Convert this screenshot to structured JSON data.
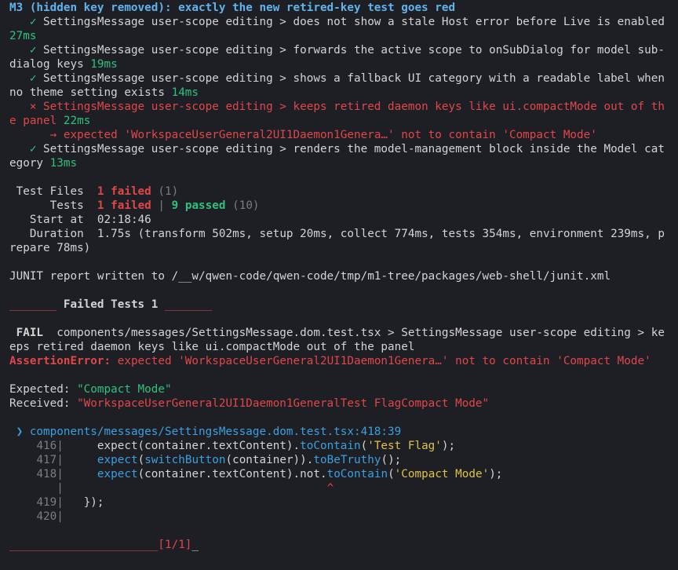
{
  "header": "M3 (hidden key removed): exactly the new retired-key test goes red",
  "tests": [
    {
      "mark": "✓",
      "status": "pass",
      "text": "SettingsMessage user-scope editing > does not show a stale Host error before Live is enabled ",
      "time": "27ms"
    },
    {
      "mark": "✓",
      "status": "pass",
      "text": "SettingsMessage user-scope editing > forwards the active scope to onSubDialog for model sub-dialog keys ",
      "time": "19ms"
    },
    {
      "mark": "✓",
      "status": "pass",
      "text": "SettingsMessage user-scope editing > shows a fallback UI category with a readable label when no theme setting exists ",
      "time": "14ms"
    },
    {
      "mark": "×",
      "status": "fail",
      "text": "SettingsMessage user-scope editing > keeps retired daemon keys like ui.compactMode out of the panel ",
      "time": "22ms",
      "error": "→ expected 'WorkspaceUserGeneral2UI1Daemon1Genera…' not to contain 'Compact Mode'"
    },
    {
      "mark": "✓",
      "status": "pass",
      "text": "SettingsMessage user-scope editing > renders the model-management block inside the Model category ",
      "time": "13ms"
    }
  ],
  "summary": {
    "files_label": "Test Files",
    "files_failed": "1 failed",
    "files_total": "(1)",
    "tests_label": "Tests",
    "tests_failed": "1 failed",
    "tests_sep": "|",
    "tests_passed": "9 passed",
    "tests_total": "(10)",
    "start_label": "Start at",
    "start_value": "02:18:46",
    "duration_label": "Duration",
    "duration_value": "1.75s (transform 502ms, setup 20ms, collect 774ms, tests 354ms, environment 239ms, prepare 78ms)"
  },
  "junit": "JUNIT report written to /__w/qwen-code/qwen-code/tmp/m1-tree/packages/web-shell/junit.xml",
  "failed_tests": {
    "rule_left": "_______",
    "title": "Failed Tests 1",
    "rule_right": "_______"
  },
  "fail_block": {
    "badge": "FAIL",
    "path": "components/messages/SettingsMessage.dom.test.tsx > SettingsMessage user-scope editing > keeps retired daemon keys like ui.compactMode out of the panel",
    "assertion_name": "AssertionError:",
    "assertion_msg": "expected 'WorkspaceUserGeneral2UI1Daemon1Genera…' not to contain 'Compact Mode'",
    "expected_label": "Expected:",
    "expected_value": "\"Compact Mode\"",
    "received_label": "Received:",
    "received_value": "\"WorkspaceUserGeneral2UI1Daemon1GeneralTest FlagCompact Mode\""
  },
  "location": {
    "arrow": "❯",
    "file": "components/messages/SettingsMessage.dom.test.tsx:418:39"
  },
  "code": [
    {
      "num": "416",
      "text": "    expect(container.textContent).toContain('Test Flag');"
    },
    {
      "num": "417",
      "text": "    expect(switchButton(container)).toBeTruthy();"
    },
    {
      "num": "418",
      "text": "    expect(container.textContent).not.toContain('Compact Mode');"
    },
    {
      "num": "",
      "text": "                                      ^"
    },
    {
      "num": "419",
      "text": "  });"
    },
    {
      "num": "420",
      "text": ""
    }
  ],
  "footer": {
    "rule": "______________________",
    "counter": "[1/1]",
    "cursor": "_"
  }
}
